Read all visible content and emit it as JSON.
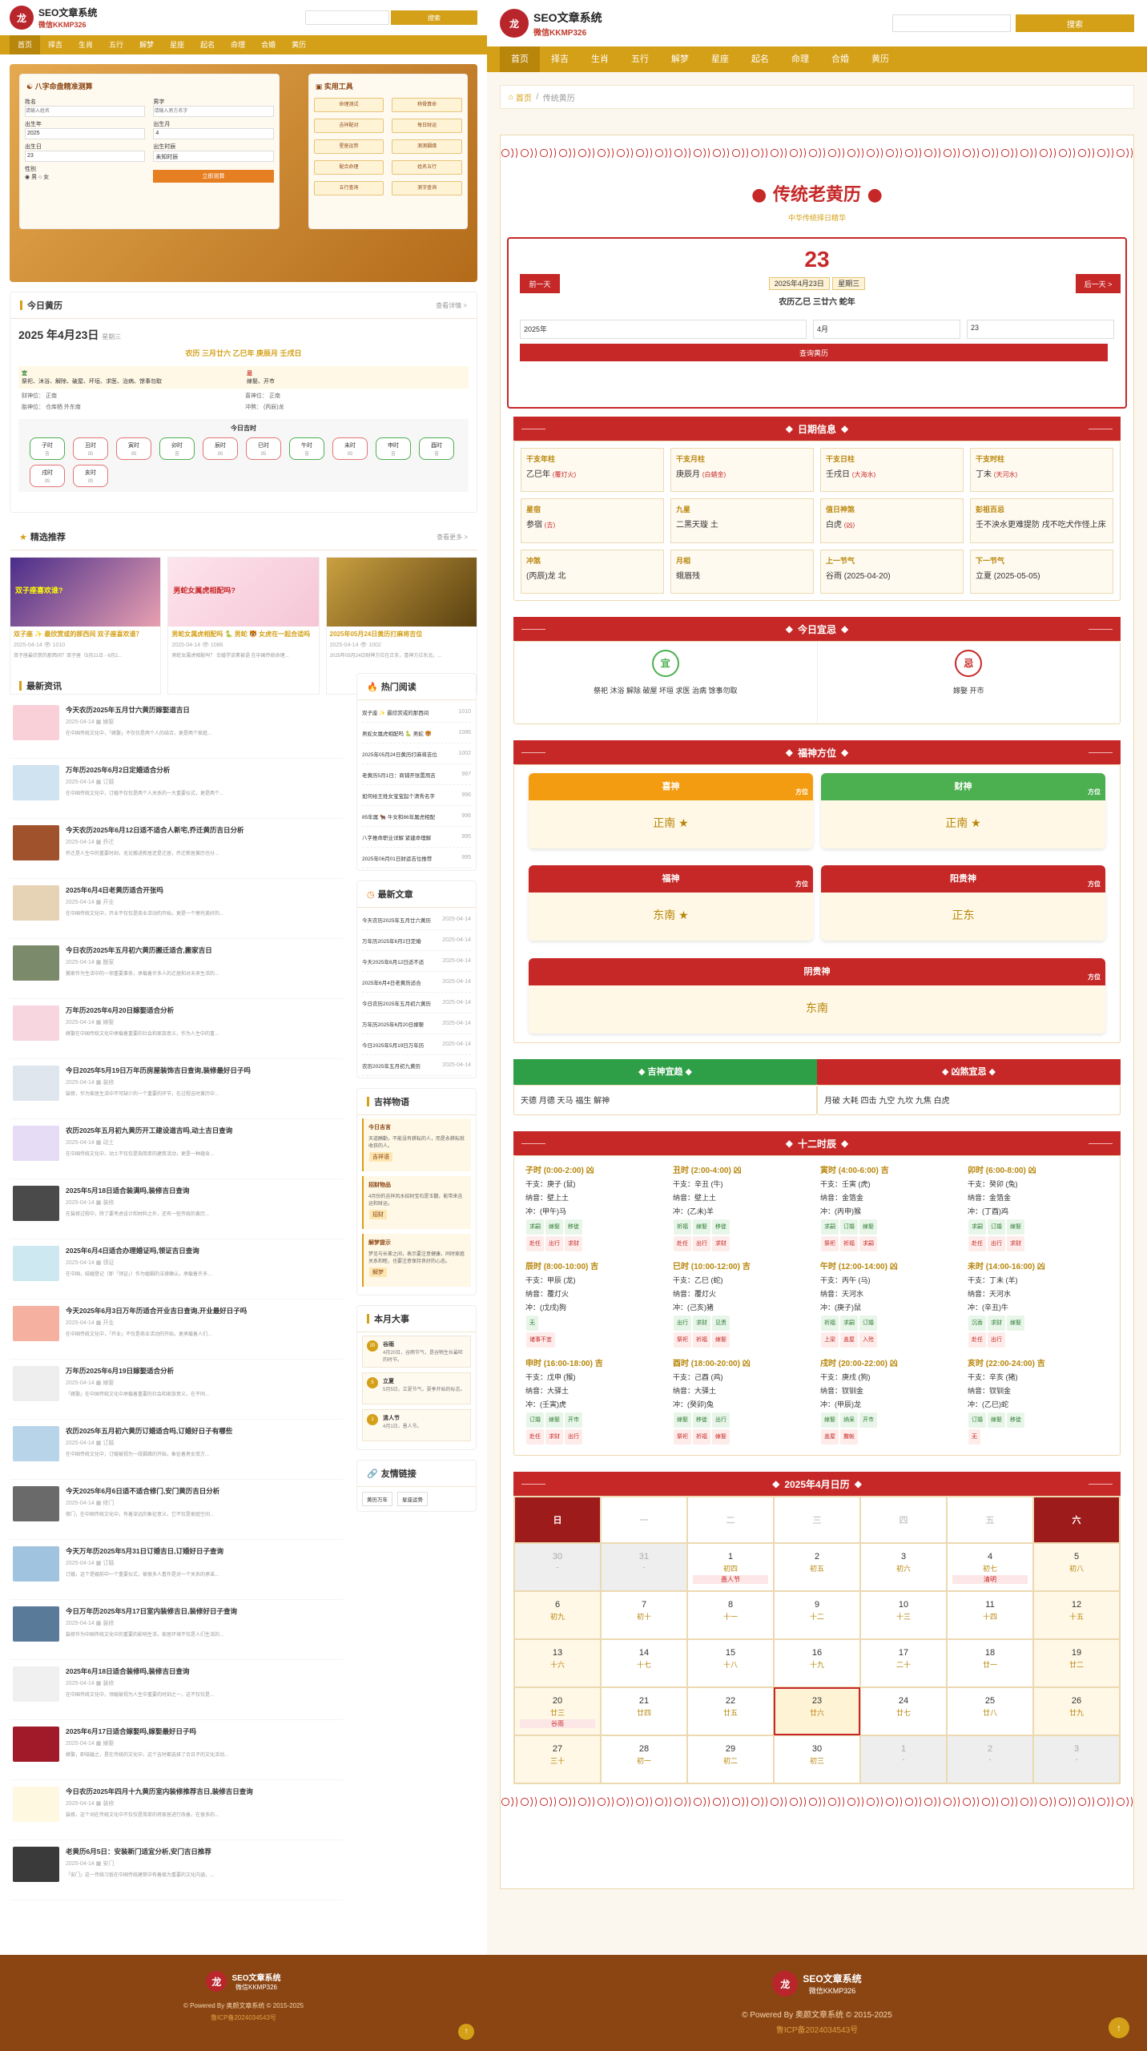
{
  "site": {
    "name": "SEO文章系统",
    "sub": "微信KKMP326",
    "logo": "龙"
  },
  "nav": [
    "首页",
    "择吉",
    "生肖",
    "五行",
    "解梦",
    "星座",
    "起名",
    "命理",
    "合婚",
    "黄历"
  ],
  "search": {
    "button": "搜索"
  },
  "bazi": {
    "title": "八字命盘精准测算",
    "name_label": "姓名",
    "name_ph": "请输入姓名",
    "surname_label": "男字",
    "surname_ph": "请输入男方名字",
    "year_label": "出生年",
    "year": "2025",
    "month_label": "出生月",
    "month": "4",
    "day_label": "出生日",
    "day": "23",
    "hour_label": "出生时辰",
    "hour": "未知时辰",
    "gender_label": "性别",
    "male": "男",
    "female": "女",
    "submit": "立即测算"
  },
  "tools": {
    "title": "实用工具",
    "items": [
      "命理测试",
      "称骨算命",
      "吉祥配对",
      "每日财运",
      "星座运势",
      "测测姻缘",
      "配合命理",
      "姓名五行",
      "五行查询",
      "测字查询"
    ]
  },
  "today": {
    "title": "今日黄历",
    "more": "查看详情 >",
    "date": "2025 年4月23日",
    "weekday": "星期三",
    "lunar": "农历 三月廿六 乙巳年 庚辰月 壬戌日",
    "yi_label": "宜",
    "yi": "祭祀、沐浴、解除、破屋、坏垣、求医、治病、馀事勿取",
    "ji_label": "忌",
    "ji": "嫁娶、开市",
    "sha1": "财神位：",
    "sha1v": "正南",
    "shen1": "喜神位：",
    "shen1v": "正南",
    "sha2": "胎神位：",
    "sha2v": "仓库栖 外东南",
    "shen2": "冲煞：",
    "shen2v": "(丙辰)龙",
    "hours_title": "今日吉时",
    "hours": [
      "子时",
      "丑时",
      "寅时",
      "卯时",
      "辰时",
      "巳时",
      "午时",
      "未时",
      "申时",
      "酉时",
      "戌时",
      "亥时"
    ],
    "hours_tags": [
      "吉",
      "凶",
      "凶",
      "吉",
      "凶",
      "凶",
      "吉",
      "凶",
      "吉",
      "吉",
      "凶",
      "凶"
    ]
  },
  "featured": {
    "title": "精选推荐",
    "more": "查看更多 >",
    "items": [
      {
        "cap": "双子座 ✨ 最欣赏或的那西间 双子座喜欢谁？",
        "date": "2025-04-14",
        "views": "1010",
        "desc": "双子座最欣赏的那西间？双子座（5月21日 - 6月2...",
        "banner": "双子座喜欢谁?"
      },
      {
        "cap": "男蛇女属虎相配吗 🐍 男蛇 🐯 女虎在一起合适吗",
        "date": "2025-04-14",
        "views": "1086",
        "desc": "男蛇女属虎相配吗？ 合婚学说素被语 在中国传统命理...",
        "banner": "男蛇女属虎相配吗?"
      },
      {
        "cap": "2025年05月24日黄历打麻将吉位",
        "date": "2025-04-14",
        "views": "1002",
        "desc": "2025年05月24日财神方位在正东，喜神方位东北，..."
      }
    ]
  },
  "news": {
    "title": "最新资讯",
    "items": [
      {
        "t": "今天农历2025年五月廿六黄历嫁娶道吉日",
        "c": "嫁娶",
        "d": "在中国传统文化中，「嫁娶」不仅仅是两个人的结合，更是两个家庭..."
      },
      {
        "t": "万年历2025年6月2日定婚适合分析",
        "c": "订婚",
        "d": "在中国传统文化中，订婚不仅仅是两个人关系的一大重要仪式，更是两个..."
      },
      {
        "t": "今天农历2025年6月12日适不适合人新宅,乔迁黄历吉日分析",
        "c": "乔迁",
        "d": "乔迁是人生中的重要时刻，无论搬进新居还是迁居，乔迁新居黄历也分..."
      },
      {
        "t": "2025年6月4日老黄历适合开张吗",
        "c": "开业",
        "d": "在中国传统文化中，开业不仅仅是商业活动的开始，更是一个寄托美好的..."
      },
      {
        "t": "今日农历2025年五月初六黄历搬迁适合,搬家吉日",
        "c": "搬家",
        "d": "搬家作为生活中的一项重要事务，承载着许多人的迁居和对未来生活的..."
      },
      {
        "t": "万年历2025年6月20日嫁娶适合分析",
        "c": "嫁娶",
        "d": "嫁娶在中国传统文化中承载着重要的社会和家族意义，作为人生中的重..."
      },
      {
        "t": "今日2025年5月19日万年历房屋装饰吉日查询,装修最好日子吗",
        "c": "装修",
        "d": "装修，作为家居生活中不可缺少的一个重要的环节，在过程吉时黄历中..."
      },
      {
        "t": "农历2025年五月初九黄历开工建设道吉吗,动土吉日查询",
        "c": "动土",
        "d": "在中国传统文化中，动土不仅仅是指简单的建筑活动，更是一种蕴含..."
      },
      {
        "t": "2025年5月18日适合装满吗,装修吉日查询",
        "c": "装修",
        "d": "在装修过程中，除了要考虑设计和材料之外，还有一些传统的黄历..."
      },
      {
        "t": "2025年6月4日适合办理婚证吗,领证吉日查询",
        "c": "领证",
        "d": "在中国，结婚登记（即「领证」）作为婚姻的法律确认，承载着许多..."
      },
      {
        "t": "今天2025年6月3日万年历适合开业吉日查询,开业最好日子吗",
        "c": "开业",
        "d": "在中国传统文化中，「开业」不仅是商业活动的开始，更承载着人们..."
      },
      {
        "t": "万年历2025年6月19日嫁娶适合分析",
        "c": "嫁娶",
        "d": "「嫁娶」在中国传统文化中承载着重要的社会和家族意义，在不同..."
      },
      {
        "t": "农历2025年五月初六黄历订婚适合吗,订婚好日子有哪些",
        "c": "订婚",
        "d": "在中国传统文化中，订婚被视为一段姻缘的开始，象征着男女双方..."
      },
      {
        "t": "今天2025年6月6日适不适合修门,安门黄历吉日分析",
        "c": "修门",
        "d": "修门，在中国传统文化中，有着深远的象征意义，它不仅是家庭空间..."
      },
      {
        "t": "今天万年历2025年5月31日订婚吉日,订婚好日子查询",
        "c": "订婚",
        "d": "订婚，这个是婚前中一个重要仪式，被很多人看作是对一个关系的承诺..."
      },
      {
        "t": "今日万年历2025年5月17日室内装修吉日,装修好日子查询",
        "c": "装修",
        "d": "装修作为中国传统文化中的重要的影响生活，家居环境不仅是人们生活的..."
      },
      {
        "t": "2025年6月18日适合装修吗,装修吉日查询",
        "c": "装修",
        "d": "在中国传统文化中，领婚被视为人生中重要的时刻之一，这不仅仅是..."
      },
      {
        "t": "2025年6月17日适合嫁娶吗,嫁娶最好日子吗",
        "c": "嫁娶",
        "d": "嫁娶，即结婚之，是在传统的文化中，这个吉时都选择了合日子的文化活动..."
      },
      {
        "t": "今日农历2025年四月十九黄历室内装修推荐吉日,装修吉日查询",
        "c": "装修",
        "d": "装修，这个词在传统文化中不仅仅是简单的将家居进行改善，在很多的..."
      },
      {
        "t": "老黄历6月5日：安装新门适宜分析,安门吉日推荐",
        "c": "安门",
        "d": "「安门」这一传统习俗在中国传统建筑中有着极为重要的文化内涵，..."
      }
    ]
  },
  "news_date": "2025-04-14",
  "hot": {
    "title": "热门阅读",
    "items": [
      "双子座 ✨ 最欣赏或的那西间",
      "男蛇女属虎相配吗 🐍 男蛇 🐯",
      "2025年05月24日黄历打麻将吉位",
      "老黄历5月1日：商铺开张置用吉",
      "如何给王姓女宝宝起个清秀名字",
      "85年属 🐂 牛女和86年属虎相配",
      "八字推命职业详解 紧建命理解",
      "2025年06月01日财运吉位推荐"
    ],
    "views": [
      "1010",
      "1086",
      "1002",
      "997",
      "996",
      "996",
      "995",
      "995"
    ]
  },
  "latest": {
    "title": "最新文章",
    "items": [
      "今天农历2025年五月廿六黄历",
      "万年历2025年6月2日定婚",
      "今天2025年6月12日适不适",
      "2025年6月4日老黄历适合",
      "今日农历2025年五月初六黄历",
      "万年历2025年6月20日嫁娶",
      "今日2025年5月19日万年历",
      "农历2025年五月初九黄历"
    ],
    "date": "2025-04-14"
  },
  "quotes": {
    "title": "吉祥物语",
    "items": [
      {
        "h": "今日吉言",
        "b": "天道酬勤，不能没有耕耘的人，而是永耕耘就收获的人。",
        "tag": "吉祥语"
      },
      {
        "h": "招财物品",
        "b": "4月份的吉祥风水招财宝石是玉髓，能带来吉运和财运。",
        "tag": "招财"
      },
      {
        "h": "解梦提示",
        "b": "梦见与长辈之间，表示要注意健康，同时家庭关系和睦，也要注意保持良好的心态。",
        "tag": "解梦"
      }
    ]
  },
  "events": {
    "title": "本月大事",
    "items": [
      {
        "h": "谷雨",
        "b": "4月20日，谷雨节气，是谷物生长最旺的时节。",
        "n": "20"
      },
      {
        "h": "立夏",
        "b": "5月5日，立夏节气，夏季开始的标志。",
        "n": "5"
      },
      {
        "h": "清人节",
        "b": "4月1日，愚人节。",
        "n": "1"
      }
    ]
  },
  "links": {
    "title": "友情链接",
    "items": [
      "黄历万年",
      "星座运势"
    ]
  },
  "breadcrumb": {
    "home": "首页",
    "current": "传统黄历"
  },
  "almanac": {
    "title": "传统老黄历",
    "subtitle": "中华传统择日精华",
    "day": "23",
    "date_line": "2025年4月23日",
    "week": "星期三",
    "ganzhi": "农历乙巳 三廿六 蛇年",
    "prev": "前一天",
    "next": "后一天 >",
    "year_sel": "2025年",
    "month_sel": "4月",
    "day_sel": "23",
    "query": "查询黄历"
  },
  "info": {
    "title": "日期信息",
    "cells": [
      {
        "k": "干支年柱",
        "v": "乙巳年",
        "e": "(覆灯火)"
      },
      {
        "k": "干支月柱",
        "v": "庚辰月",
        "e": "(白蜡金)"
      },
      {
        "k": "干支日柱",
        "v": "壬戌日",
        "e": "(大海水)"
      },
      {
        "k": "干支时柱",
        "v": "丁未",
        "e": "(天河水)"
      },
      {
        "k": "星宿",
        "v": "参宿",
        "e": "(吉)"
      },
      {
        "k": "九星",
        "v": "二黑天璇 土",
        "e": ""
      },
      {
        "k": "值日神煞",
        "v": "白虎",
        "e": "(凶)"
      },
      {
        "k": "彭祖百忌",
        "v": "壬不泱水更难提防 戌不吃犬作怪上床",
        "e": ""
      },
      {
        "k": "冲煞",
        "v": "(丙辰)龙 北",
        "e": ""
      },
      {
        "k": "月相",
        "v": "蛾眉残",
        "e": ""
      },
      {
        "k": "上一节气",
        "v": "谷雨 (2025-04-20)",
        "e": ""
      },
      {
        "k": "下一节气",
        "v": "立夏 (2025-05-05)",
        "e": ""
      }
    ]
  },
  "yiji": {
    "title": "今日宜忌",
    "yi": "宜",
    "yi_text": "祭祀 沐浴 解除 破屋 坏垣 求医 治病 馀事勿取",
    "ji": "忌",
    "ji_text": "嫁娶 开市"
  },
  "gods": {
    "title": "福神方位",
    "dir_label": "方位",
    "items": [
      {
        "n": "喜神",
        "v": "正南",
        "c": "#f39c12"
      },
      {
        "n": "财神",
        "v": "正南",
        "c": "#4caf50"
      },
      {
        "n": "福神",
        "v": "东南",
        "c": "#c62828"
      },
      {
        "n": "阳贵神",
        "v": "正东",
        "c": "#c62828"
      },
      {
        "n": "阴贵神",
        "v": "东南",
        "c": "#c62828"
      }
    ]
  },
  "jishen": {
    "good": "吉神宜趋",
    "bad": "凶煞宜忌",
    "good_text": "天德 月德 天马 福生 解神",
    "bad_text": "月破 大耗 四击 九空 九坎 九焦 白虎"
  },
  "shichen": {
    "title": "十二时辰",
    "items": [
      {
        "h": "子时 (0:00-2:00) 凶",
        "g": "干支：庚子 (鼠)",
        "n": "纳音：壁上土",
        "c": "冲：(甲午)马",
        "y": [
          "求嗣",
          "嫁娶",
          "移徙"
        ],
        "j": [
          "赴任",
          "出行",
          "求财"
        ]
      },
      {
        "h": "丑时 (2:00-4:00) 凶",
        "g": "干支：辛丑 (牛)",
        "n": "纳音：壁上土",
        "c": "冲：(乙未)羊",
        "y": [
          "祈福",
          "嫁娶",
          "移徙"
        ],
        "j": [
          "赴任",
          "出行",
          "求财"
        ]
      },
      {
        "h": "寅时 (4:00-6:00) 吉",
        "g": "干支：壬寅 (虎)",
        "n": "纳音：金箔金",
        "c": "冲：(丙申)猴",
        "y": [
          "求嗣",
          "订婚",
          "嫁娶"
        ],
        "j": [
          "祭祀",
          "祈福",
          "求嗣"
        ]
      },
      {
        "h": "卯时 (6:00-8:00) 凶",
        "g": "干支：癸卯 (兔)",
        "n": "纳音：金箔金",
        "c": "冲：(丁酉)鸡",
        "y": [
          "求嗣",
          "订婚",
          "嫁娶"
        ],
        "j": [
          "赴任",
          "出行",
          "求财"
        ]
      },
      {
        "h": "辰时 (8:00-10:00) 吉",
        "g": "干支：甲辰 (龙)",
        "n": "纳音：覆灯火",
        "c": "冲：(戊戌)狗",
        "y": [
          "无"
        ],
        "j": [
          "诸事不宜"
        ]
      },
      {
        "h": "巳时 (10:00-12:00) 吉",
        "g": "干支：乙巳 (蛇)",
        "n": "纳音：覆灯火",
        "c": "冲：(己亥)猪",
        "y": [
          "出行",
          "求财",
          "见贵"
        ],
        "j": [
          "祭祀",
          "祈福",
          "嫁娶"
        ]
      },
      {
        "h": "午时 (12:00-14:00) 凶",
        "g": "干支：丙午 (马)",
        "n": "纳音：天河水",
        "c": "冲：(庚子)鼠",
        "y": [
          "祈福",
          "求嗣",
          "订婚"
        ],
        "j": [
          "上梁",
          "盖屋",
          "入殓"
        ]
      },
      {
        "h": "未时 (14:00-16:00) 凶",
        "g": "干支：丁未 (羊)",
        "n": "纳音：天河水",
        "c": "冲：(辛丑)牛",
        "y": [
          "沉香",
          "求财",
          "嫁娶"
        ],
        "j": [
          "赴任",
          "出行"
        ]
      },
      {
        "h": "申时 (16:00-18:00) 吉",
        "g": "干支：戊申 (猴)",
        "n": "纳音：大驿土",
        "c": "冲：(壬寅)虎",
        "y": [
          "订婚",
          "嫁娶",
          "开市"
        ],
        "j": [
          "赴任",
          "求财",
          "出行"
        ]
      },
      {
        "h": "酉时 (18:00-20:00) 凶",
        "g": "干支：己酉 (鸡)",
        "n": "纳音：大驿土",
        "c": "冲：(癸卯)兔",
        "y": [
          "嫁娶",
          "移徙",
          "出行"
        ],
        "j": [
          "祭祀",
          "祈福",
          "嫁娶"
        ]
      },
      {
        "h": "戌时 (20:00-22:00) 凶",
        "g": "干支：庚戌 (狗)",
        "n": "纳音：钗钏金",
        "c": "冲：(甲辰)龙",
        "y": [
          "嫁娶",
          "纳采",
          "开市"
        ],
        "j": [
          "盖屋",
          "撒帐"
        ]
      },
      {
        "h": "亥时 (22:00-24:00) 吉",
        "g": "干支：辛亥 (猪)",
        "n": "纳音：钗钏金",
        "c": "冲：(乙巳)蛇",
        "y": [
          "订婚",
          "嫁娶",
          "移徙"
        ],
        "j": [
          "无"
        ]
      }
    ]
  },
  "calendar": {
    "title": "2025年4月日历",
    "weekdays": [
      "日",
      "一",
      "二",
      "三",
      "四",
      "五",
      "六"
    ],
    "days": [
      {
        "d": "30",
        "l": "-",
        "o": true
      },
      {
        "d": "31",
        "l": "-",
        "o": true
      },
      {
        "d": "1",
        "l": "初四",
        "t": "愚人节"
      },
      {
        "d": "2",
        "l": "初五"
      },
      {
        "d": "3",
        "l": "初六"
      },
      {
        "d": "4",
        "l": "初七",
        "t": "清明"
      },
      {
        "d": "5",
        "l": "初八"
      },
      {
        "d": "6",
        "l": "初九"
      },
      {
        "d": "7",
        "l": "初十"
      },
      {
        "d": "8",
        "l": "十一"
      },
      {
        "d": "9",
        "l": "十二"
      },
      {
        "d": "10",
        "l": "十三"
      },
      {
        "d": "11",
        "l": "十四"
      },
      {
        "d": "12",
        "l": "十五"
      },
      {
        "d": "13",
        "l": "十六"
      },
      {
        "d": "14",
        "l": "十七"
      },
      {
        "d": "15",
        "l": "十八"
      },
      {
        "d": "16",
        "l": "十九"
      },
      {
        "d": "17",
        "l": "二十"
      },
      {
        "d": "18",
        "l": "廿一"
      },
      {
        "d": "19",
        "l": "廿二"
      },
      {
        "d": "20",
        "l": "廿三",
        "t": "谷雨"
      },
      {
        "d": "21",
        "l": "廿四"
      },
      {
        "d": "22",
        "l": "廿五"
      },
      {
        "d": "23",
        "l": "廿六",
        "s": true
      },
      {
        "d": "24",
        "l": "廿七"
      },
      {
        "d": "25",
        "l": "廿八"
      },
      {
        "d": "26",
        "l": "廿九"
      },
      {
        "d": "27",
        "l": "三十"
      },
      {
        "d": "28",
        "l": "初一"
      },
      {
        "d": "29",
        "l": "初二"
      },
      {
        "d": "30",
        "l": "初三"
      },
      {
        "d": "1",
        "l": "-",
        "o": true
      },
      {
        "d": "2",
        "l": "-",
        "o": true
      },
      {
        "d": "3",
        "l": "-",
        "o": true
      }
    ]
  },
  "foot": {
    "powered": "© Powered By 奥颜文章系统 © 2015-2025",
    "icp": "鲁ICP备2024034543号",
    "powered_r": "© Powered By 奥颜文章系统 © 2015-2025",
    "icp_r": "鲁ICP备2024034543号"
  }
}
